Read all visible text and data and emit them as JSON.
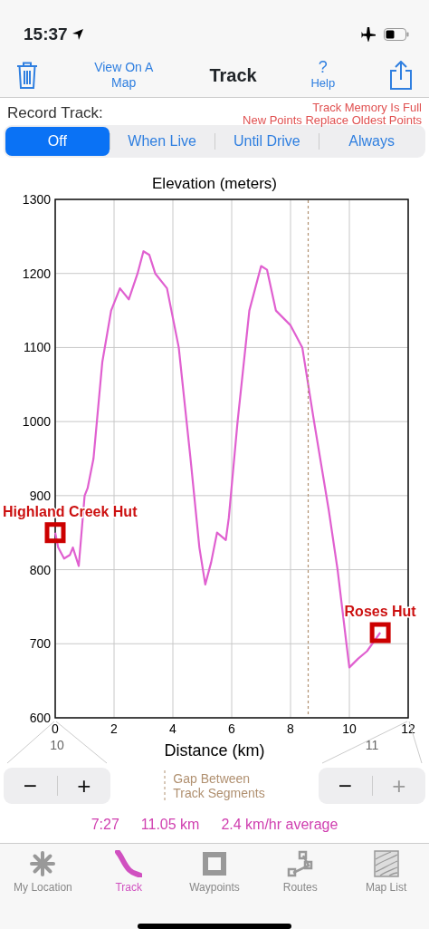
{
  "status_bar": {
    "time": "15:37"
  },
  "nav_bar": {
    "map_link": "View On A Map",
    "title": "Track",
    "help_mark": "?",
    "help_label": "Help"
  },
  "record": {
    "label": "Record Track:",
    "warning_line_1": "Track Memory Is Full",
    "warning_line_2": "New Points Replace Oldest Points",
    "options": [
      {
        "label": "Off",
        "selected": true
      },
      {
        "label": "When Live",
        "selected": false
      },
      {
        "label": "Until Drive",
        "selected": false
      },
      {
        "label": "Always",
        "selected": false
      }
    ]
  },
  "chart_data": {
    "type": "line",
    "title": "Elevation (meters)",
    "xlabel": "Distance (km)",
    "xlim": [
      0,
      12
    ],
    "ylim": [
      600,
      1300
    ],
    "xticks": [
      0,
      2,
      4,
      6,
      8,
      10,
      12
    ],
    "yticks": [
      600,
      700,
      800,
      900,
      1000,
      1100,
      1200,
      1300
    ],
    "x": [
      0,
      0.1,
      0.3,
      0.5,
      0.6,
      0.8,
      1.0,
      1.1,
      1.3,
      1.6,
      1.9,
      2.2,
      2.5,
      2.8,
      3.0,
      3.2,
      3.4,
      3.8,
      4.2,
      4.6,
      4.9,
      5.1,
      5.3,
      5.5,
      5.8,
      5.9,
      6.2,
      6.6,
      7.0,
      7.2,
      7.5,
      8.0,
      8.4,
      8.8,
      9.3,
      9.6,
      9.9,
      10.0,
      10.3,
      10.6,
      11.05
    ],
    "grid": true,
    "series": [
      {
        "color": "#e060d0",
        "values": [
          850,
          830,
          815,
          820,
          830,
          805,
          900,
          910,
          950,
          1080,
          1150,
          1180,
          1165,
          1200,
          1230,
          1225,
          1200,
          1180,
          1100,
          950,
          830,
          780,
          810,
          850,
          840,
          870,
          1000,
          1150,
          1210,
          1205,
          1150,
          1130,
          1100,
          1000,
          880,
          800,
          700,
          668,
          680,
          690,
          715
        ]
      }
    ],
    "annotations": [
      {
        "text": "Highland Creek Hut",
        "x": 0,
        "y": 850
      },
      {
        "text": "Roses Hut",
        "x": 11.05,
        "y": 715
      }
    ],
    "ref_lines": [
      {
        "axis": "x",
        "value": 8.6,
        "color": "#b09070"
      }
    ]
  },
  "zoom_left": {
    "value": "10",
    "minus": "−",
    "plus": "+",
    "plus_disabled": false
  },
  "zoom_right": {
    "value": "11",
    "minus": "−",
    "plus": "+",
    "plus_disabled": true
  },
  "gap_legend": {
    "line_1": "Gap Between",
    "line_2": "Track Segments"
  },
  "stats": [
    {
      "text": "7:27"
    },
    {
      "text": "11.05 km"
    },
    {
      "text": "2.4 km/hr average"
    }
  ],
  "tabs": [
    {
      "label": "My Location",
      "kind": "location",
      "selected": false
    },
    {
      "label": "Track",
      "kind": "track",
      "selected": true
    },
    {
      "label": "Waypoints",
      "kind": "waypoints",
      "selected": false
    },
    {
      "label": "Routes",
      "kind": "routes",
      "selected": false
    },
    {
      "label": "Map List",
      "kind": "maps",
      "selected": false
    }
  ]
}
